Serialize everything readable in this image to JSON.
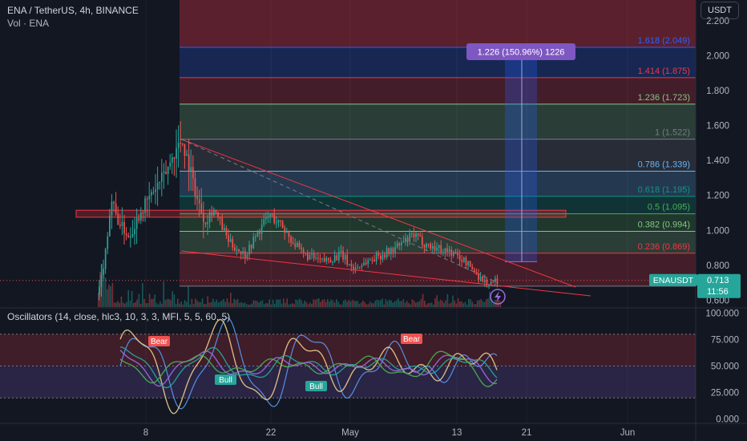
{
  "header": {
    "symbol_line": "ENA / TetherUS, 4h, BINANCE",
    "volume_line": "Vol · ENA"
  },
  "currency_button": "USDT",
  "price_label": {
    "ticker": "ENAUSDT",
    "price": "0.713",
    "countdown": "11:56"
  },
  "measure_label": "1.226 (150.96%) 1226",
  "oscillator": {
    "title": "Oscillators (14, close, hlc3, 10, 3, 3, MFI, 5, 5, 60, 5)",
    "bear_label": "Bear",
    "bull_label": "Bull"
  },
  "colors": {
    "background": "#131722",
    "bull": "#26a69a",
    "bear": "#ef5350",
    "trendline": "#f23645",
    "measure": "#2962ff",
    "measure_label": "#7e57c2"
  },
  "icons": {
    "replay": "lightning-icon"
  },
  "chart_data": [
    {
      "type": "candlestick",
      "title": "",
      "x_tick_labels": [
        "8",
        "22",
        "May",
        "13",
        "21",
        "Jun"
      ],
      "y_ticks": [
        0.6,
        0.8,
        1.0,
        1.2,
        1.4,
        1.6,
        1.8,
        2.0,
        2.2
      ],
      "y_tick_labels": [
        "0.600",
        "0.800",
        "1.000",
        "1.200",
        "1.400",
        "1.600",
        "1.800",
        "2.000",
        "2.200"
      ],
      "ylim": [
        0.56,
        2.32
      ],
      "last_price": 0.713,
      "swing_high": 1.522,
      "swing_low": 0.68,
      "fib_levels": [
        {
          "ratio": "0.236",
          "label": "0.236 (0.869)",
          "price": 0.869,
          "color": "#f23645"
        },
        {
          "ratio": "0.382",
          "label": "0.382 (0.994)",
          "price": 0.994,
          "color": "#81c784"
        },
        {
          "ratio": "0.5",
          "label": "0.5 (1.095)",
          "price": 1.095,
          "color": "#4caf50"
        },
        {
          "ratio": "0.618",
          "label": "0.618 (1.195)",
          "price": 1.195,
          "color": "#089981"
        },
        {
          "ratio": "0.786",
          "label": "0.786 (1.339)",
          "price": 1.339,
          "color": "#64b5f6"
        },
        {
          "ratio": "1",
          "label": "1 (1.522)",
          "price": 1.522,
          "color": "#787b86"
        },
        {
          "ratio": "1.236",
          "label": "1.236 (1.723)",
          "price": 1.723,
          "color": "#81c784"
        },
        {
          "ratio": "1.414",
          "label": "1.414 (1.875)",
          "price": 1.875,
          "color": "#f23645"
        },
        {
          "ratio": "1.618",
          "label": "1.618 (2.049)",
          "price": 2.049,
          "color": "#2962ff"
        }
      ],
      "resistance_zone": [
        1.075,
        1.115
      ],
      "measure_projection": {
        "from": 0.82,
        "to": 2.049
      }
    },
    {
      "type": "line",
      "title": "",
      "y_ticks": [
        0,
        25,
        50,
        75,
        100
      ],
      "y_tick_labels": [
        "0.000",
        "25.000",
        "50.000",
        "75.000",
        "100.000"
      ],
      "ylim": [
        -4,
        104
      ],
      "bands": {
        "upper": 80,
        "middle": 50,
        "lower": 20
      },
      "series_colors": [
        "#5b9cf6",
        "#e8c98a",
        "#26a69a",
        "#9c6ade",
        "#4caf50"
      ]
    }
  ]
}
